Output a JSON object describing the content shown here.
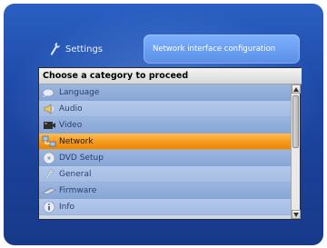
{
  "header": {
    "title": "Settings",
    "title_icon": "wrench-icon",
    "description": "Network interface configuration"
  },
  "panel": {
    "heading": "Choose a category to proceed",
    "items": [
      {
        "label": "Language",
        "icon": "language-icon"
      },
      {
        "label": "Audio",
        "icon": "speaker-icon"
      },
      {
        "label": "Video",
        "icon": "video-icon"
      },
      {
        "label": "Network",
        "icon": "network-icon",
        "selected": true
      },
      {
        "label": "DVD Setup",
        "icon": "disc-icon"
      },
      {
        "label": "General",
        "icon": "wrench-icon"
      },
      {
        "label": "Firmware",
        "icon": "chip-icon"
      },
      {
        "label": "Info",
        "icon": "info-icon"
      }
    ]
  },
  "colors": {
    "background": "#1e4aa8",
    "selected_item": "#f59a1c",
    "description_box": "#6a9ef0"
  }
}
